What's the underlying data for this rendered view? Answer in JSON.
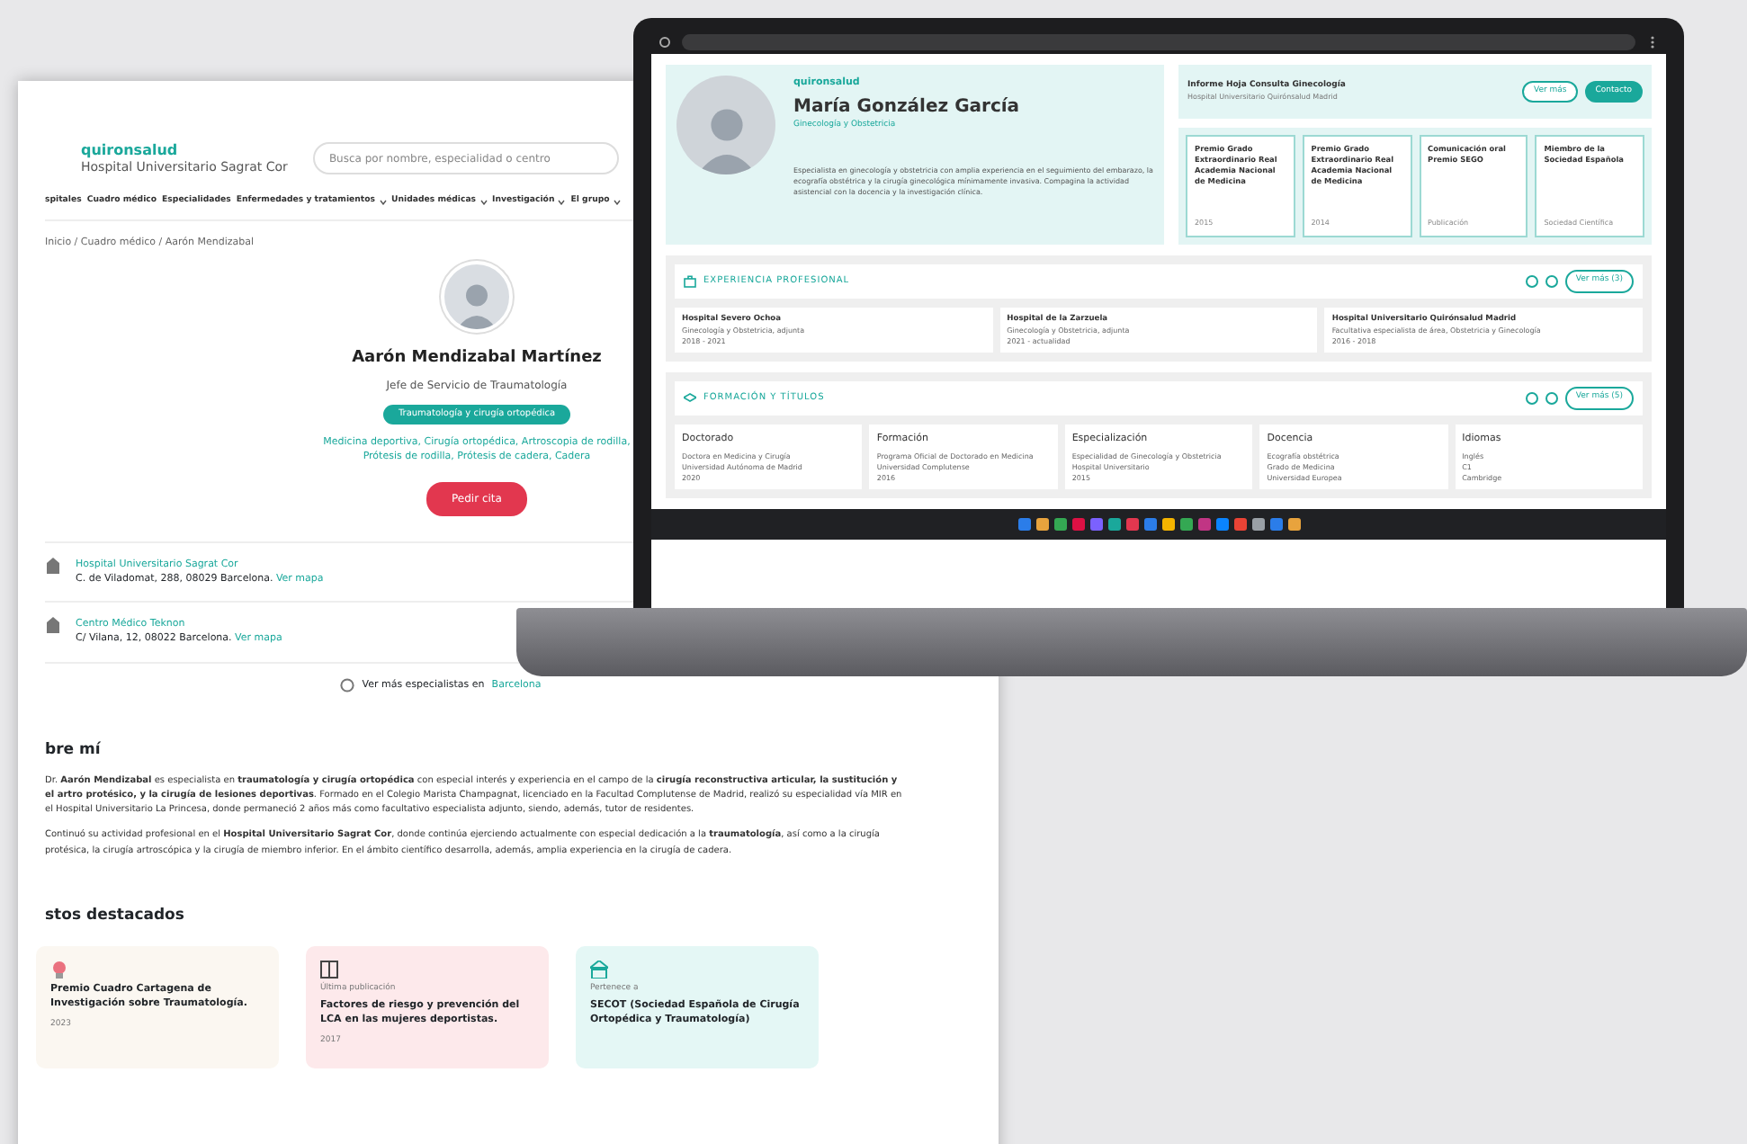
{
  "back_page": {
    "logo": {
      "name": "quironsalud",
      "tagline": "Hospital Universitario Sagrat Cor"
    },
    "search": {
      "placeholder": "Busca por nombre, especialidad o centro"
    },
    "nav": [
      {
        "label": "spitales",
        "has_menu": false
      },
      {
        "label": "Cuadro médico",
        "has_menu": false
      },
      {
        "label": "Especialidades",
        "has_menu": false
      },
      {
        "label": "Enfermedades y tratamientos",
        "has_menu": true
      },
      {
        "label": "Unidades médicas",
        "has_menu": true
      },
      {
        "label": "Investigación",
        "has_menu": true
      },
      {
        "label": "El grupo",
        "has_menu": true
      }
    ],
    "breadcrumb": "Inicio / Cuadro médico / Aarón Mendizabal",
    "doctor": {
      "name": "Aarón Mendizabal Martínez",
      "role": "Jefe de Servicio de Traumatología",
      "badge": "Traumatología y cirugía ortopédica",
      "specialties": "Medicina deportiva, Cirugía ortopédica, Artroscopia de rodilla, Prótesis de rodilla, Prótesis de cadera, Cadera",
      "button": "Pedir cita"
    },
    "centers": [
      {
        "name": "Hospital Universitario Sagrat Cor",
        "address": "C. de Viladomat, 288, 08029 Barcelona.",
        "link": "Ver mapa"
      },
      {
        "name": "Centro Médico Teknon",
        "address": "C/ Vilana, 12, 08022 Barcelona.",
        "link": "Ver mapa"
      }
    ],
    "more": {
      "text": "Ver más especialistas en",
      "link": "Barcelona"
    },
    "about": {
      "title": "bre mí",
      "paragraphs": [
        "Dr. **Aarón Mendizabal** es especialista en **traumatología y cirugía ortopédica** con especial interés y experiencia en el campo de la **cirugía reconstructiva articular, la sustitución y el artro protésico, y la cirugía de lesiones deportivas**. Formado en el Colegio Marista Champagnat, licenciado en la Facultad Complutense de Madrid, realizó su especialidad vía MIR en el Hospital Universitario La Princesa, donde permaneció 2 años más como facultativo especialista adjunto, siendo, además, tutor de residentes.",
        "Continuó su actividad profesional en el **Hospital Universitario Sagrat Cor**, donde continúa ejerciendo actualmente con especial dedicación a la **traumatología**, así como a la cirugía protésica, la cirugía artroscópica y la cirugía de miembro inferior. En el ámbito científico desarrolla, además, amplia experiencia en la cirugía de cadera."
      ]
    },
    "highlights": {
      "title": "stos destacados",
      "cards": [
        {
          "kind": "award",
          "title": "Premio Cuadro Cartagena de Investigación sobre Traumatología.",
          "year": "2023",
          "color": "#fbf7f1"
        },
        {
          "kind": "publication",
          "label": "Última publicación",
          "title": "Factores de riesgo y prevención del LCA en las mujeres deportistas.",
          "year": "2017",
          "color": "#fde9eb"
        },
        {
          "kind": "society",
          "label": "Pertenece a",
          "title": "SECOT (Sociedad Española de Cirugía Ortopédica y Traumatología)",
          "color": "#e4f7f5"
        }
      ]
    }
  },
  "laptop": {
    "profile": {
      "logo": "quironsalud",
      "name": "María González García",
      "subtitle": "Ginecología y Obstetricia",
      "bio": "Especialista en ginecología y obstetricia con amplia experiencia en el seguimiento del embarazo, la ecografía obstétrica y la cirugía ginecológica mínimamente invasiva. Compagina la actividad asistencial con la docencia y la investigación clínica."
    },
    "info": {
      "title": "Informe Hoja Consulta Ginecología",
      "subtitle": "Hospital Universitario Quirónsalud Madrid",
      "buttons": [
        {
          "label": "Ver más",
          "primary": false
        },
        {
          "label": "Contacto",
          "primary": true
        }
      ]
    },
    "awards": [
      {
        "title": "Premio Grado Extraordinario Real Academia Nacional de Medicina",
        "year": "2015"
      },
      {
        "title": "Premio Grado Extraordinario Real Academia Nacional de Medicina",
        "year": "2014"
      },
      {
        "title": "Comunicación oral Premio SEGO",
        "year": "Publicación"
      },
      {
        "title": "Miembro de la Sociedad Española",
        "year": "Sociedad Científica"
      }
    ],
    "sections": [
      {
        "kind": "experience",
        "title": "EXPERIENCIA PROFESIONAL",
        "button": "Ver más (3)",
        "items": [
          {
            "title": "Hospital Severo Ochoa",
            "lines": [
              "Ginecología y Obstetricia, adjunta",
              "2018 - 2021"
            ]
          },
          {
            "title": "Hospital de la Zarzuela",
            "lines": [
              "Ginecología y Obstetricia, adjunta",
              "2021 - actualidad"
            ]
          },
          {
            "title": "Hospital Universitario Quirónsalud Madrid",
            "lines": [
              "Facultativa especialista de área, Obstetricia y Ginecología",
              "2016 - 2018"
            ]
          }
        ]
      },
      {
        "kind": "education",
        "title": "FORMACIÓN Y TÍTULOS",
        "button": "Ver más (5)",
        "items": [
          {
            "title": "Doctorado",
            "lines": [
              "Doctora en Medicina y Cirugía",
              "Universidad Autónoma de Madrid",
              "2020"
            ]
          },
          {
            "title": "Formación",
            "lines": [
              "Programa Oficial de Doctorado en Medicina",
              "Universidad Complutense",
              "2016"
            ]
          },
          {
            "title": "Especialización",
            "lines": [
              "Especialidad de Ginecología y Obstetricia",
              "Hospital Universitario",
              "2015"
            ]
          },
          {
            "title": "Docencia",
            "lines": [
              "Ecografía obstétrica",
              "Grado de Medicina",
              "Universidad Europea"
            ]
          },
          {
            "title": "Idiomas",
            "lines": [
              "Inglés",
              "C1",
              "Cambridge"
            ]
          }
        ]
      }
    ]
  }
}
